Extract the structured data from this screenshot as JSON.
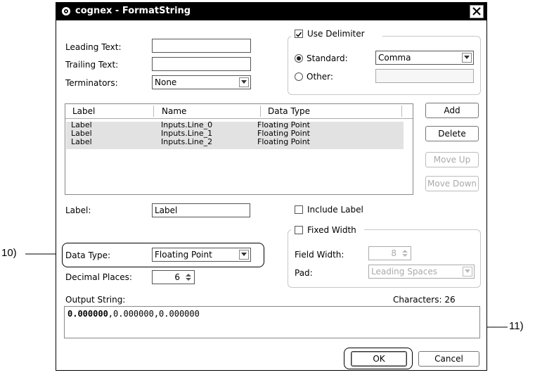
{
  "window": {
    "title": "cognex - FormatString"
  },
  "fields": {
    "leading_text_label": "Leading Text:",
    "leading_text_value": "",
    "trailing_text_label": "Trailing Text:",
    "trailing_text_value": "",
    "terminators_label": "Terminators:",
    "terminators_value": "None"
  },
  "delimiter": {
    "use_delimiter_label": "Use Delimiter",
    "use_delimiter_checked": true,
    "standard_label": "Standard:",
    "standard_value": "Comma",
    "other_label": "Other:",
    "other_value": ""
  },
  "table": {
    "columns": [
      "Label",
      "Name",
      "Data Type"
    ],
    "rows": [
      {
        "label": "Label",
        "name": "Inputs.Line_0",
        "type": "Floating Point"
      },
      {
        "label": "Label",
        "name": "Inputs.Line_1",
        "type": "Floating Point"
      },
      {
        "label": "Label",
        "name": "Inputs.Line_2",
        "type": "Floating Point"
      }
    ]
  },
  "side_buttons": {
    "add": "Add",
    "delete": "Delete",
    "move_up": "Move Up",
    "move_down": "Move Down"
  },
  "item": {
    "label_label": "Label:",
    "label_value": "Label",
    "include_label": "Include Label",
    "fixed_width": "Fixed Width",
    "field_width_label": "Field Width:",
    "field_width_value": "8",
    "pad_label": "Pad:",
    "pad_value": "Leading Spaces",
    "data_type_label": "Data Type:",
    "data_type_value": "Floating Point",
    "decimal_places_label": "Decimal Places:",
    "decimal_places_value": "6"
  },
  "output": {
    "label": "Output String:",
    "characters_label": "Characters: 26",
    "value_bold": "0.000000",
    "value_rest": ",0.000000,0.000000"
  },
  "buttons": {
    "ok": "OK",
    "cancel": "Cancel"
  },
  "callouts": {
    "c10": "10)",
    "c11": "11)"
  }
}
